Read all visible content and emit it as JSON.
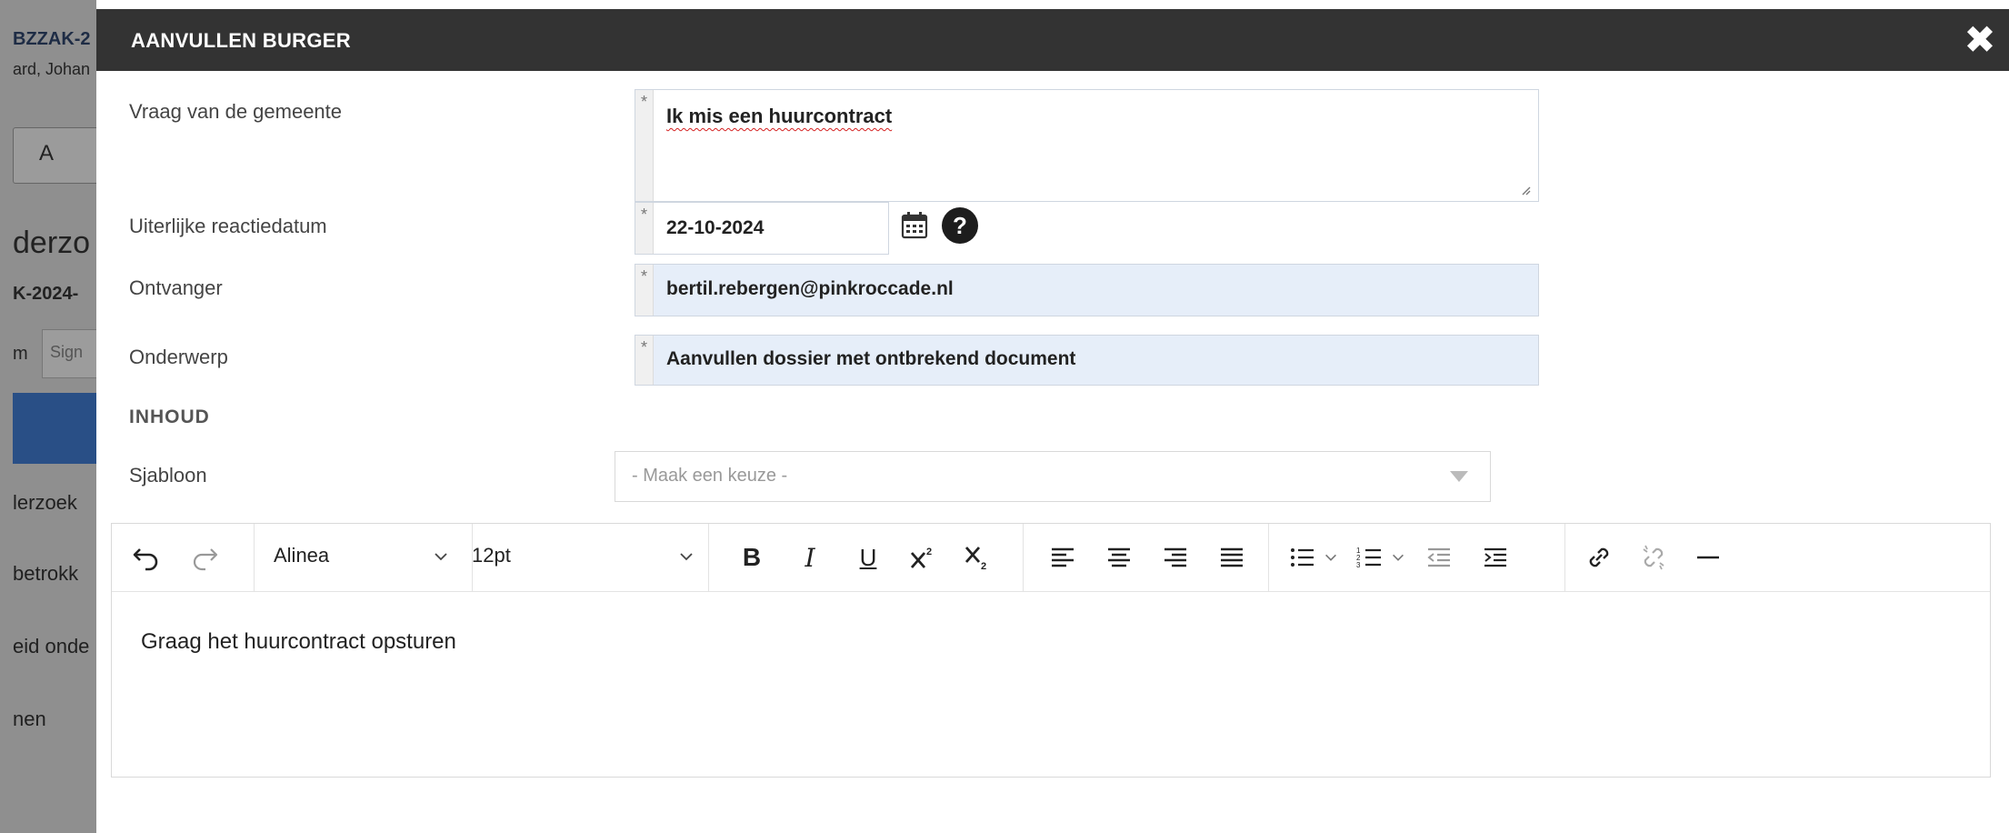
{
  "background": {
    "lines": [
      "BZZAK-2",
      "ard, Johan",
      "derzo",
      "K-2024-",
      "m",
      "Sign",
      "lerzoek",
      "betrokk",
      "eid onde",
      "nen"
    ],
    "button_label": "A"
  },
  "modal": {
    "title": "AANVULLEN BURGER",
    "close_label": "✖",
    "fields": {
      "question": {
        "label": "Vraag van de gemeente",
        "value": "Ik mis een huurcontract"
      },
      "deadline": {
        "label": "Uiterlijke reactiedatum",
        "value": "22-10-2024"
      },
      "recipient": {
        "label": "Ontvanger",
        "value": "bertil.rebergen@pinkroccade.nl"
      },
      "subject": {
        "label": "Onderwerp",
        "value": "Aanvullen dossier met ontbrekend document"
      }
    },
    "required_marker": "*",
    "help_label": "?",
    "section_title": "INHOUD",
    "template": {
      "label": "Sjabloon",
      "placeholder": "- Maak een keuze -"
    },
    "editor": {
      "paragraph_style": "Alinea",
      "font_size": "12pt",
      "bold": "B",
      "italic": "I",
      "underline": "U",
      "content": "Graag het huurcontract opsturen"
    }
  }
}
